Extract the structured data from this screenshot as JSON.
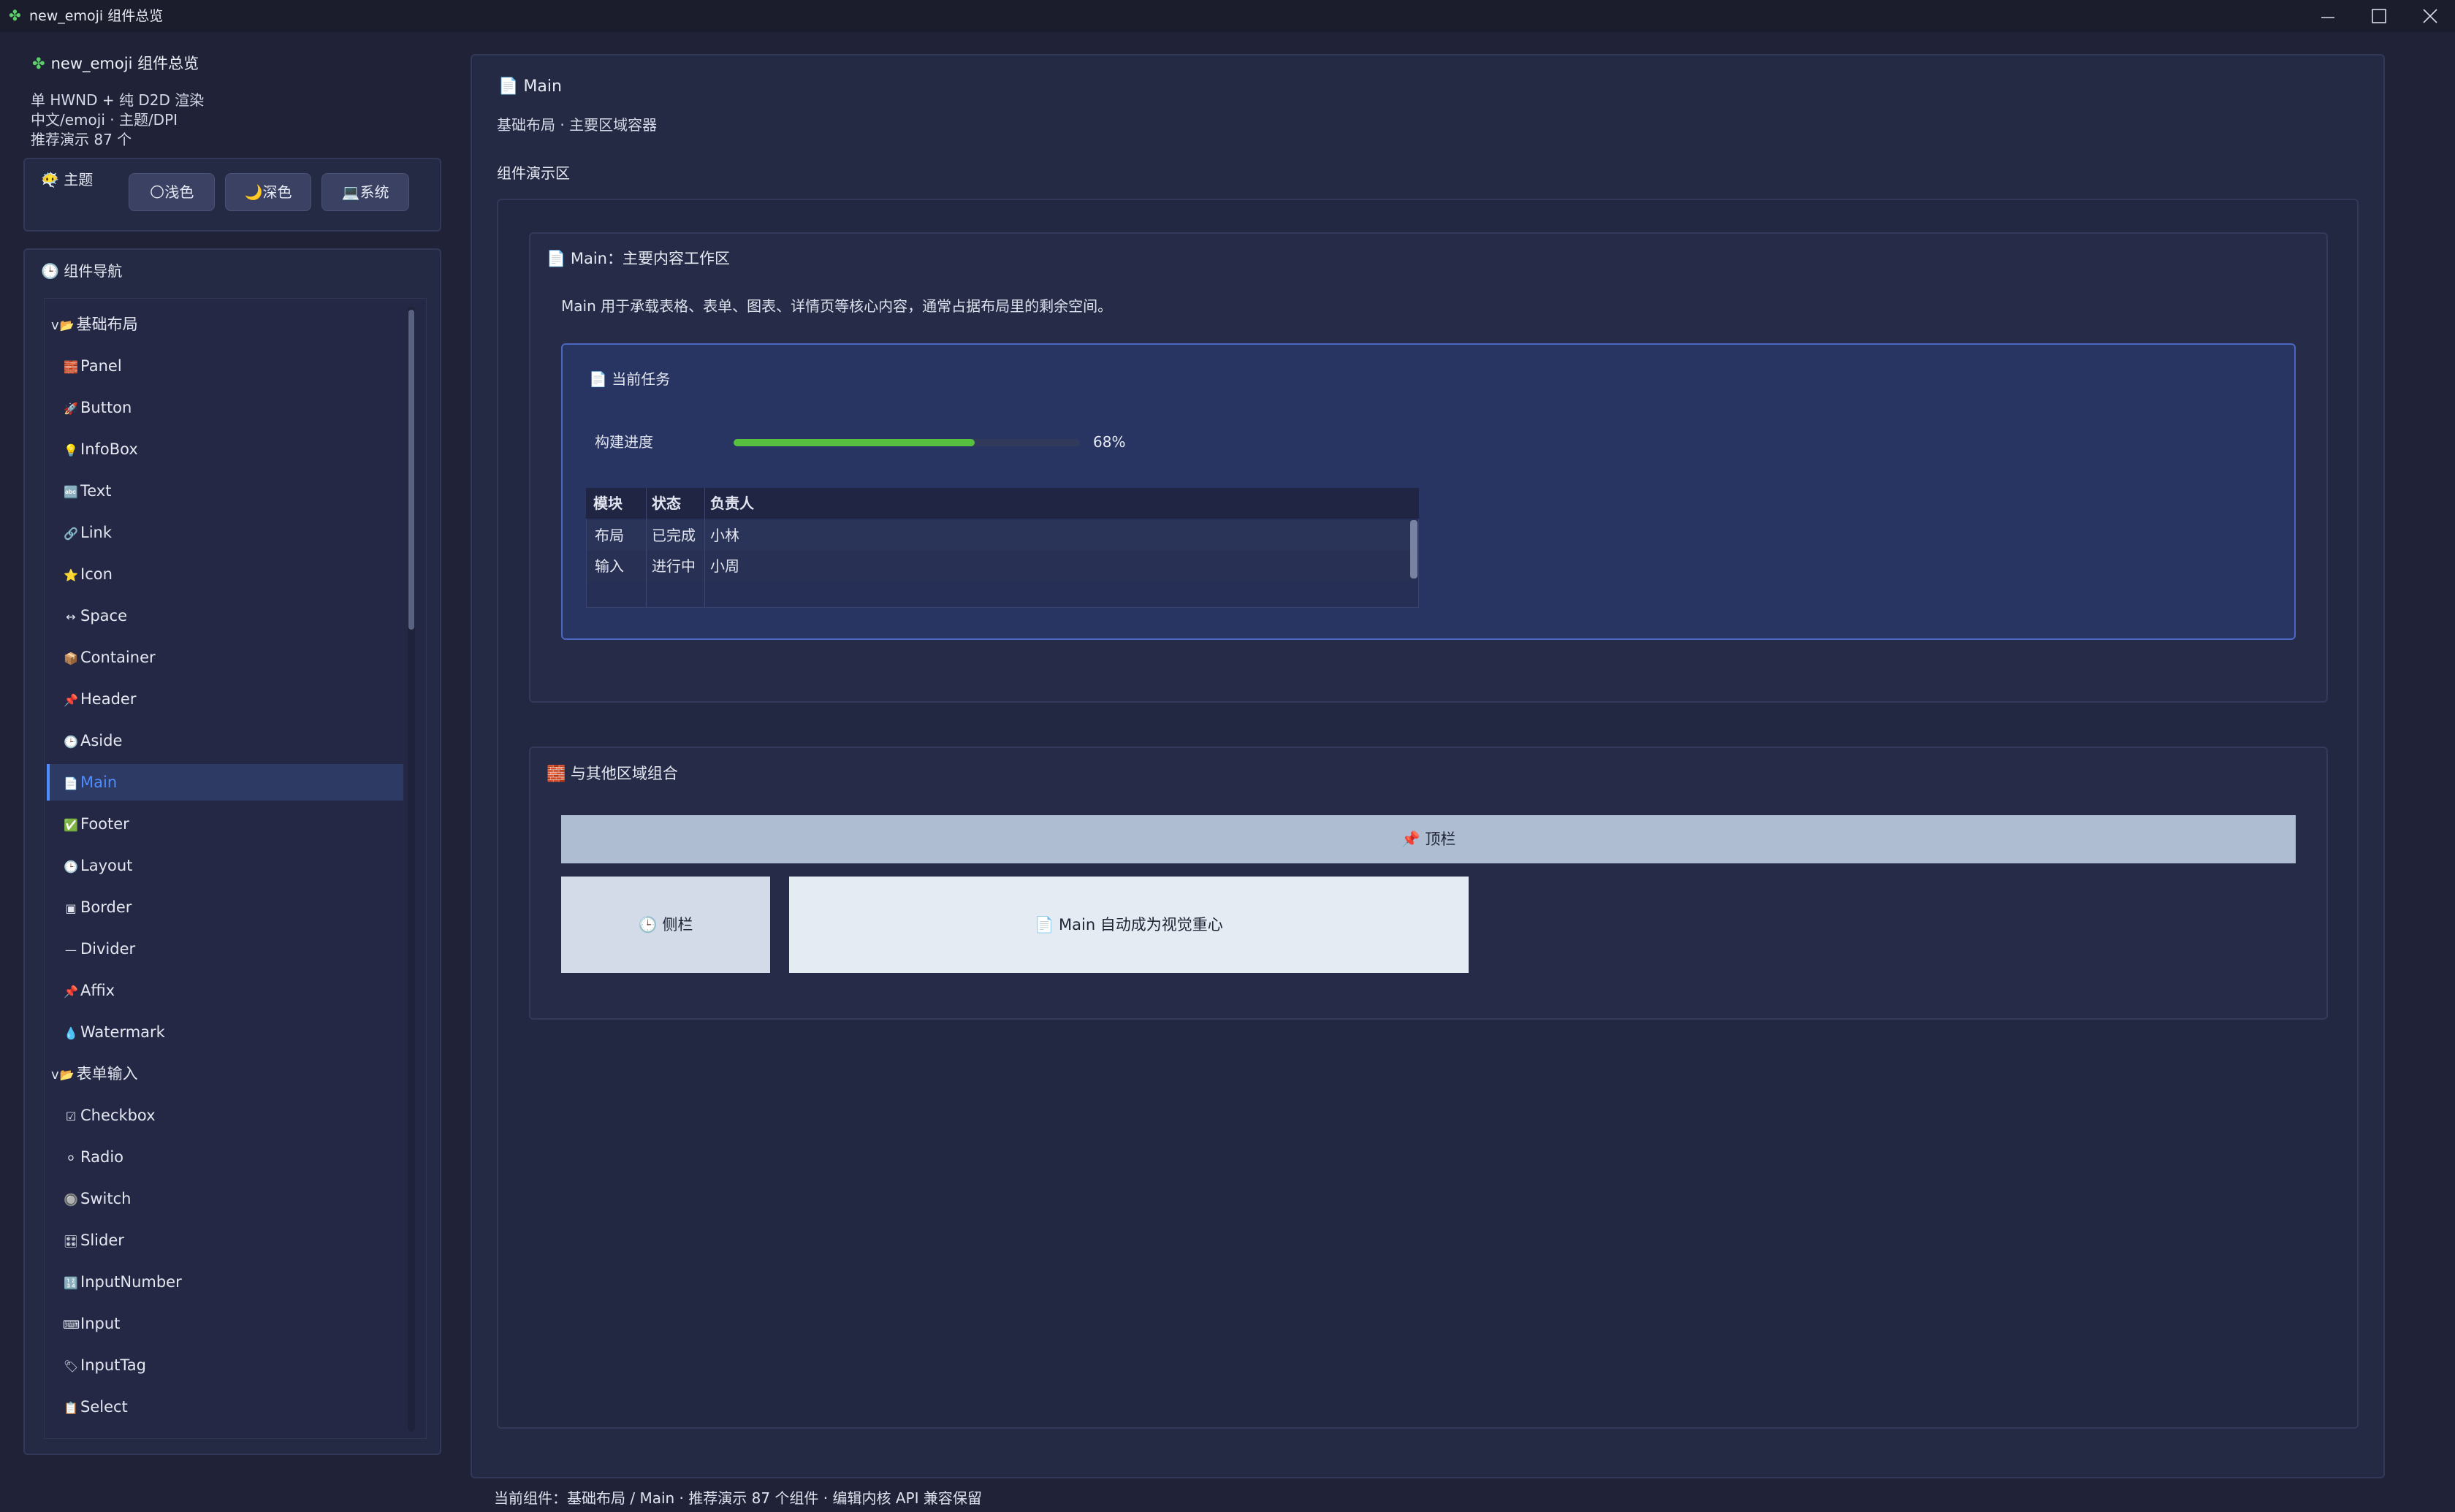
{
  "window": {
    "title": "new_emoji 组件总览",
    "app_icon": "✤"
  },
  "sidebar": {
    "app_title": "new_emoji 组件总览",
    "info_lines": [
      "单 HWND + 纯 D2D 渲染",
      "中文/emoji · 主题/DPI",
      "推荐演示 87 个"
    ],
    "theme": {
      "label": "主题",
      "buttons": [
        {
          "label": "浅色",
          "icon": "🌕"
        },
        {
          "label": "深色",
          "icon": "🌙"
        },
        {
          "label": "系统",
          "icon": "💻"
        }
      ]
    },
    "nav": {
      "label": "组件导航",
      "groups": [
        {
          "label": "基础布局",
          "items": [
            {
              "label": "Panel",
              "icon": "🧱"
            },
            {
              "label": "Button",
              "icon": "🚀"
            },
            {
              "label": "InfoBox",
              "icon": "💡"
            },
            {
              "label": "Text",
              "icon": "🔤"
            },
            {
              "label": "Link",
              "icon": "🔗"
            },
            {
              "label": "Icon",
              "icon": "⭐"
            },
            {
              "label": "Space",
              "icon": "↔"
            },
            {
              "label": "Container",
              "icon": "📦"
            },
            {
              "label": "Header",
              "icon": "📌"
            },
            {
              "label": "Aside",
              "icon": "🕒"
            },
            {
              "label": "Main",
              "icon": "📄",
              "selected": true
            },
            {
              "label": "Footer",
              "icon": "✅"
            },
            {
              "label": "Layout",
              "icon": "🕒"
            },
            {
              "label": "Border",
              "icon": "▣"
            },
            {
              "label": "Divider",
              "icon": "—"
            },
            {
              "label": "Affix",
              "icon": "📌"
            },
            {
              "label": "Watermark",
              "icon": "💧"
            }
          ]
        },
        {
          "label": "表单输入",
          "items": [
            {
              "label": "Checkbox",
              "icon": "☑"
            },
            {
              "label": "Radio",
              "icon": "⚪"
            },
            {
              "label": "Switch",
              "icon": "🔘"
            },
            {
              "label": "Slider",
              "icon": "🎛"
            },
            {
              "label": "InputNumber",
              "icon": "🔢"
            },
            {
              "label": "Input",
              "icon": "⌨"
            },
            {
              "label": "InputTag",
              "icon": "🏷"
            },
            {
              "label": "Select",
              "icon": "📋"
            }
          ]
        }
      ]
    }
  },
  "main": {
    "title": "Main",
    "subtitle": "基础布局 · 主要区域容器",
    "demo_label": "组件演示区",
    "section1": {
      "title": "Main：主要内容工作区",
      "description": "Main 用于承载表格、表单、图表、详情页等核心内容，通常占据布局里的剩余空间。",
      "task": {
        "title": "当前任务",
        "progress_label": "构建进度",
        "progress_value": 0.68,
        "progress_text": "68%",
        "table": {
          "headers": [
            "模块",
            "状态",
            "负责人"
          ],
          "rows": [
            [
              "布局",
              "已完成",
              "小林"
            ],
            [
              "输入",
              "进行中",
              "小周"
            ]
          ]
        }
      }
    },
    "section2": {
      "title": "与其他区域组合",
      "top_label": "📌 顶栏",
      "aside_label": "🕒 侧栏",
      "main_label": "📄 Main 自动成为视觉重心"
    }
  },
  "status_bar": "当前组件：基础布局 / Main · 推荐演示 87 个组件 · 编辑内核 API 兼容保留"
}
